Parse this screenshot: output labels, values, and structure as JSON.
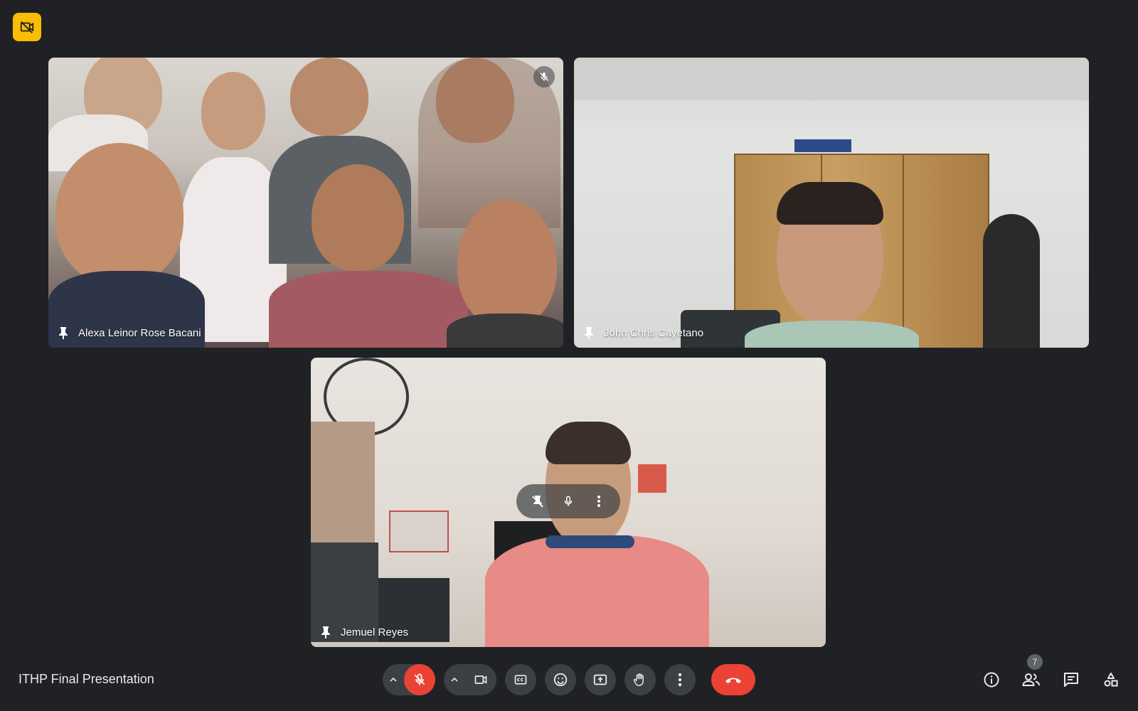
{
  "meeting": {
    "title": "ITHP Final Presentation",
    "participant_count": "7"
  },
  "tiles": [
    {
      "name": "Alexa Leinor Rose Bacani",
      "muted": true
    },
    {
      "name": "John Chris Cayetano",
      "muted": false
    },
    {
      "name": "Jemuel Reyes",
      "muted": false
    }
  ],
  "colors": {
    "background": "#202124",
    "control_bg": "#3c4043",
    "danger": "#ea4335",
    "warning_badge": "#fbbc04"
  },
  "icons": {
    "top_badge": "camera-off-icon",
    "pin": "pin-icon",
    "mic_muted": "mic-off-icon",
    "camera": "camera-icon",
    "captions": "closed-captions-icon",
    "emoji": "emoji-icon",
    "present": "present-screen-icon",
    "raise_hand": "raise-hand-icon",
    "more": "more-options-icon",
    "end_call": "end-call-icon",
    "info": "info-icon",
    "people": "people-icon",
    "chat": "chat-icon",
    "activities": "activities-icon"
  }
}
